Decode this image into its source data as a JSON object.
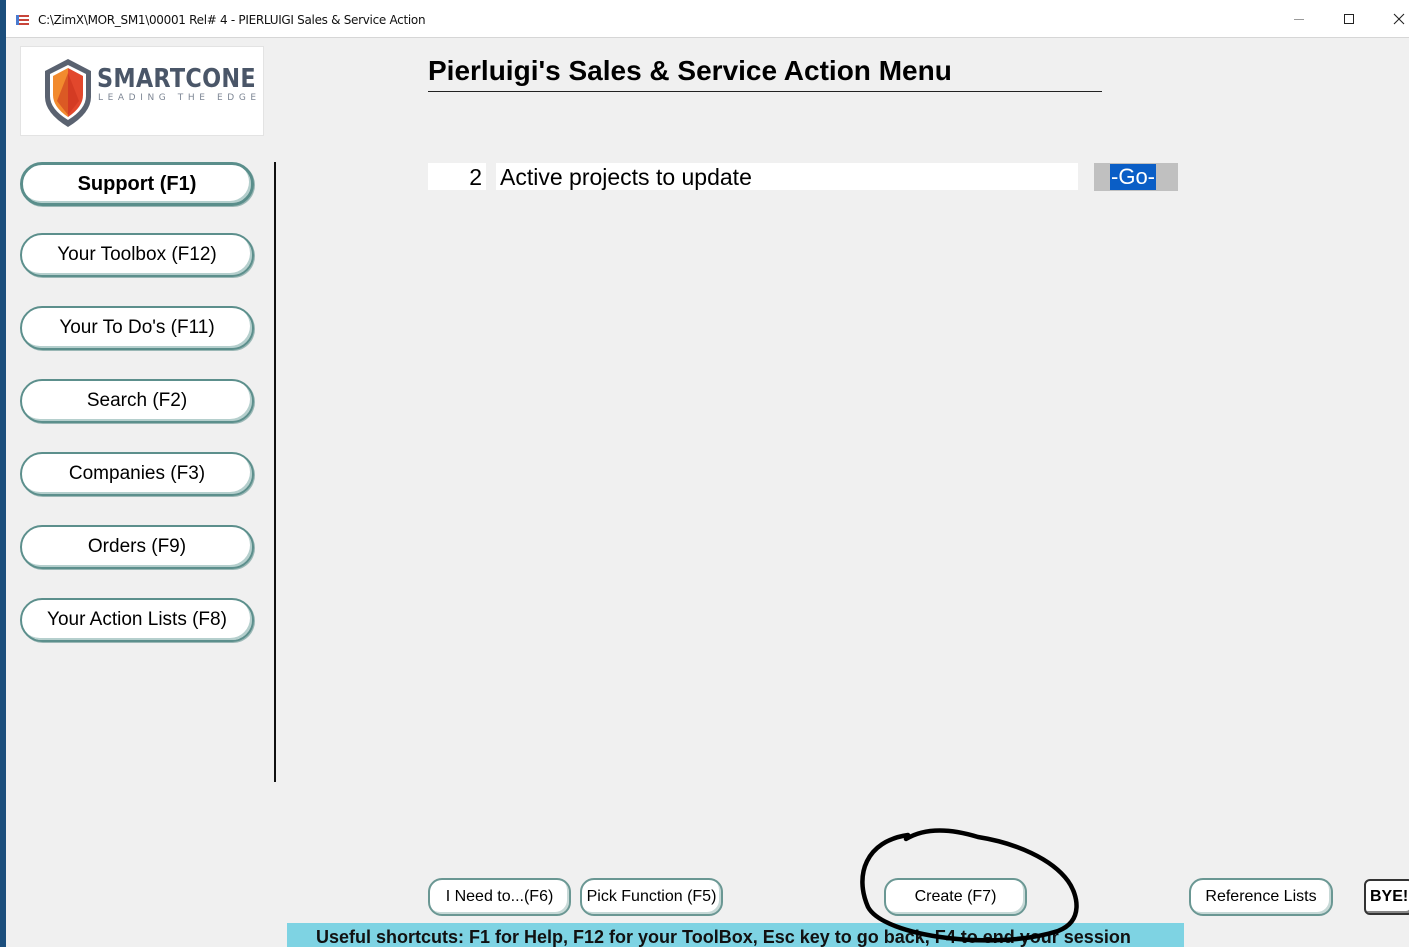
{
  "window": {
    "title": "C:\\ZimX\\MOR_SM1\\00001 Rel# 4 - PIERLUIGI Sales & Service Action"
  },
  "logo": {
    "name": "SMARTCONE",
    "tagline": "LEADING THE EDGE",
    "colors": {
      "shield_red": "#e2472c",
      "shield_orange": "#f28a2e",
      "shield_gray": "#5a6270"
    }
  },
  "sidebar": {
    "items": [
      {
        "label": "Support (F1)"
      },
      {
        "label": "Your Toolbox (F12)"
      },
      {
        "label": "Your To Do's (F11)"
      },
      {
        "label": "Search (F2)"
      },
      {
        "label": "Companies (F3)"
      },
      {
        "label": "Orders (F9)"
      },
      {
        "label": "Your Action Lists (F8)"
      }
    ]
  },
  "main": {
    "heading": "Pierluigi's Sales & Service Action Menu",
    "actions": [
      {
        "count": "2",
        "label": "Active projects to update",
        "go_label": "-Go-"
      }
    ]
  },
  "footer": {
    "buttons": {
      "need": "I Need to...(F6)",
      "pick": "Pick Function (F5)",
      "create": "Create (F7)",
      "reference": "Reference Lists",
      "bye": "BYE!"
    },
    "shortcuts": "Useful shortcuts: F1 for Help, F12 for your ToolBox, Esc key to go back, F4 to end your session"
  },
  "colors": {
    "accent": "#0a5ec6",
    "button_border": "#5c8f8c",
    "status_bar": "#7ed3e3",
    "desktop": "#1b4e7c"
  },
  "icons": {
    "app": "app-icon",
    "minimize": "minimize-icon",
    "maximize": "maximize-icon",
    "close": "close-icon",
    "logo": "shield-logo-icon"
  }
}
